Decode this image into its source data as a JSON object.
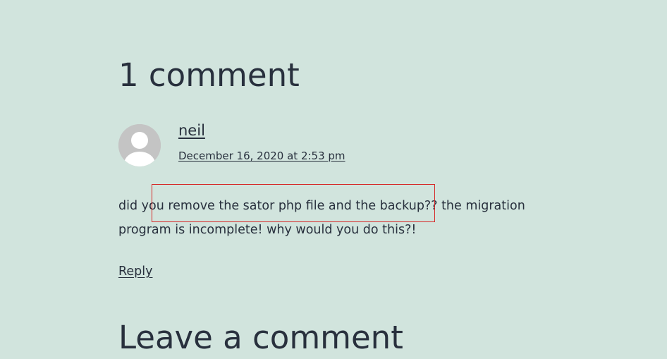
{
  "comments": {
    "title": "1 comment",
    "items": [
      {
        "author": "neil",
        "date": "December 16, 2020 at 2:53 pm",
        "body_before": "did you remove the sator php file and the backup?? the migration program is incomplete! why would you do this?!",
        "reply_label": "Reply"
      }
    ]
  },
  "reply_form": {
    "title": "Leave a comment"
  },
  "colors": {
    "background": "#d1e4dd",
    "text": "#28303d",
    "avatar": "#c4c4c4",
    "highlight_border": "#d62828"
  }
}
